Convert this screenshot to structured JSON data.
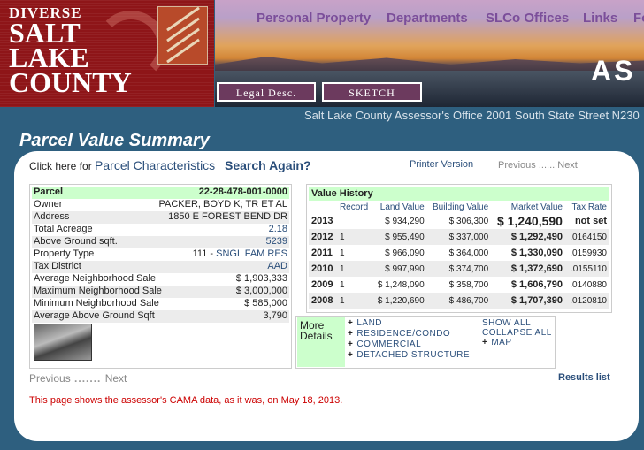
{
  "logo": {
    "line1": "DIVERSE",
    "line2": "SALT",
    "line3": "LAKE",
    "line4": "COUNTY"
  },
  "nav": {
    "items": [
      "Personal Property",
      "Departments",
      "SLCo Offices",
      "Links",
      "Fo"
    ]
  },
  "banner_text": "AS",
  "header_buttons": {
    "legal": "Legal Desc.",
    "sketch": "SKETCH"
  },
  "office_line": "Salt Lake County Assessor's Office 2001 South State Street N230",
  "page_title": "Parcel Value Summary",
  "top": {
    "click_here": "Click here for",
    "characteristics": "Parcel Characteristics",
    "search_again": "Search Again?",
    "printer": "Printer Version",
    "prev": "Previous",
    "dots": " ...... ",
    "next": "Next"
  },
  "parcel": {
    "header": {
      "label": "Parcel",
      "value": "22-28-478-001-0000"
    },
    "rows": [
      {
        "label": "Owner",
        "value": "PACKER, BOYD K; TR ET AL",
        "link": false
      },
      {
        "label": "Address",
        "value": "1850 E FOREST BEND DR",
        "link": false
      },
      {
        "label": "Total Acreage",
        "value": "2.18",
        "link": true
      },
      {
        "label": "Above Ground sqft.",
        "value": "5239",
        "link": true
      },
      {
        "label": "Property Type",
        "value": "111 - ",
        "value2": "SNGL FAM RES",
        "link": false
      },
      {
        "label": "Tax District",
        "value": "AAD",
        "link": true
      },
      {
        "label": "Average Neighborhood Sale",
        "value": "$ 1,903,333",
        "link": false
      },
      {
        "label": "Maximum Neighborhood Sale",
        "value": "$ 3,000,000",
        "link": false
      },
      {
        "label": "Minimum Neighborhood Sale",
        "value": "$ 585,000",
        "link": false
      },
      {
        "label": "Average Above Ground Sqft",
        "value": "3,790",
        "link": false
      }
    ]
  },
  "history": {
    "title": "Value History",
    "headers": [
      "",
      "Record",
      "Land Value",
      "Building Value",
      "Market Value",
      "Tax Rate"
    ],
    "rows": [
      {
        "year": "2013",
        "record": "",
        "land": "$ 934,290",
        "building": "$ 306,300",
        "market": "$ 1,240,590",
        "tax": "not set"
      },
      {
        "year": "2012",
        "record": "1",
        "land": "$ 955,490",
        "building": "$ 337,000",
        "market": "$ 1,292,490",
        "tax": ".0164150"
      },
      {
        "year": "2011",
        "record": "1",
        "land": "$ 966,090",
        "building": "$ 364,000",
        "market": "$ 1,330,090",
        "tax": ".0159930"
      },
      {
        "year": "2010",
        "record": "1",
        "land": "$ 997,990",
        "building": "$ 374,700",
        "market": "$ 1,372,690",
        "tax": ".0155110"
      },
      {
        "year": "2009",
        "record": "1",
        "land": "$ 1,248,090",
        "building": "$ 358,700",
        "market": "$ 1,606,790",
        "tax": ".0140880"
      },
      {
        "year": "2008",
        "record": "1",
        "land": "$ 1,220,690",
        "building": "$ 486,700",
        "market": "$ 1,707,390",
        "tax": ".0120810"
      }
    ]
  },
  "more": {
    "label1": "More",
    "label2": "Details",
    "items": [
      "LAND",
      "RESIDENCE/CONDO",
      "COMMERCIAL",
      "DETACHED STRUCTURE"
    ],
    "show_all": "SHOW ALL",
    "collapse_all": "COLLAPSE ALL",
    "map": "MAP"
  },
  "bottom": {
    "prev": "Previous",
    "dots": " ....... ",
    "next": "Next",
    "results": "Results list"
  },
  "note": "This page shows the assessor's CAMA data, as it was, on May 18, 2013."
}
